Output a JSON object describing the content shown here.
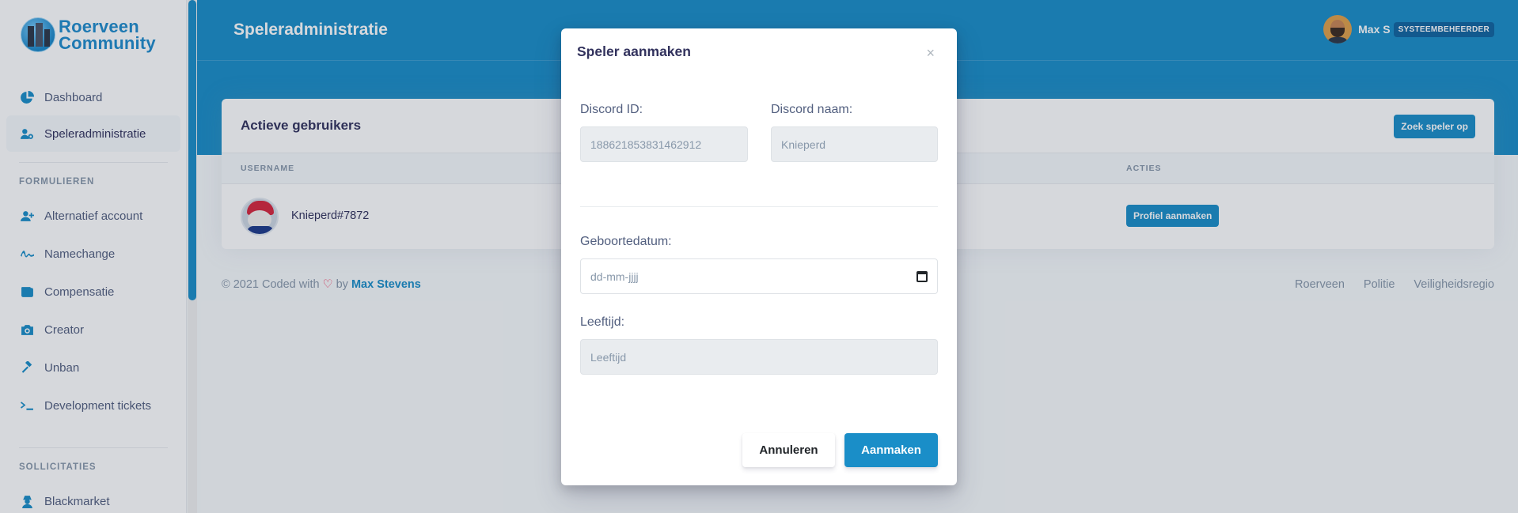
{
  "sidebar": {
    "brand_line1": "Roerveen",
    "brand_line2": "Community",
    "items": [
      {
        "label": "Dashboard",
        "icon": "chart-pie-icon"
      },
      {
        "label": "Speleradministratie",
        "icon": "users-cog-icon",
        "active": true
      }
    ],
    "forms_heading": "FORMULIEREN",
    "forms": [
      {
        "label": "Alternatief account",
        "icon": "user-plus-icon"
      },
      {
        "label": "Namechange",
        "icon": "signature-icon"
      },
      {
        "label": "Compensatie",
        "icon": "wallet-icon"
      },
      {
        "label": "Creator",
        "icon": "camera-icon"
      },
      {
        "label": "Unban",
        "icon": "gavel-icon"
      },
      {
        "label": "Development tickets",
        "icon": "terminal-icon"
      }
    ],
    "apps_heading": "SOLLICITATIES",
    "apps": [
      {
        "label": "Blackmarket",
        "icon": "user-secret-icon"
      }
    ]
  },
  "header": {
    "title": "Speleradministratie",
    "user_name": "Max S",
    "user_role": "SYSTEEMBEHEERDER"
  },
  "card": {
    "title": "Actieve gebruikers",
    "search_button": "Zoek speler op",
    "columns": [
      "USERNAME",
      "ACTIES"
    ],
    "rows": [
      {
        "username": "Knieperd#7872",
        "action": "Profiel aanmaken"
      }
    ]
  },
  "footer": {
    "copyright": "© 2021 Coded with",
    "by": "by",
    "author": "Max Stevens",
    "links": [
      "Roerveen",
      "Politie",
      "Veiligheidsregio"
    ]
  },
  "modal": {
    "title": "Speler aanmaken",
    "close": "×",
    "discord_id_label": "Discord ID:",
    "discord_id_value": "188621853831462912",
    "discord_name_label": "Discord naam:",
    "discord_name_value": "Knieperd",
    "birthdate_label": "Geboortedatum:",
    "birthdate_placeholder": "dd-mm-jjjj",
    "age_label": "Leeftijd:",
    "age_placeholder": "Leeftijd",
    "cancel_button": "Annuleren",
    "create_button": "Aanmaken"
  },
  "colors": {
    "primary": "#1a8ec8",
    "danger": "#f5365c"
  }
}
